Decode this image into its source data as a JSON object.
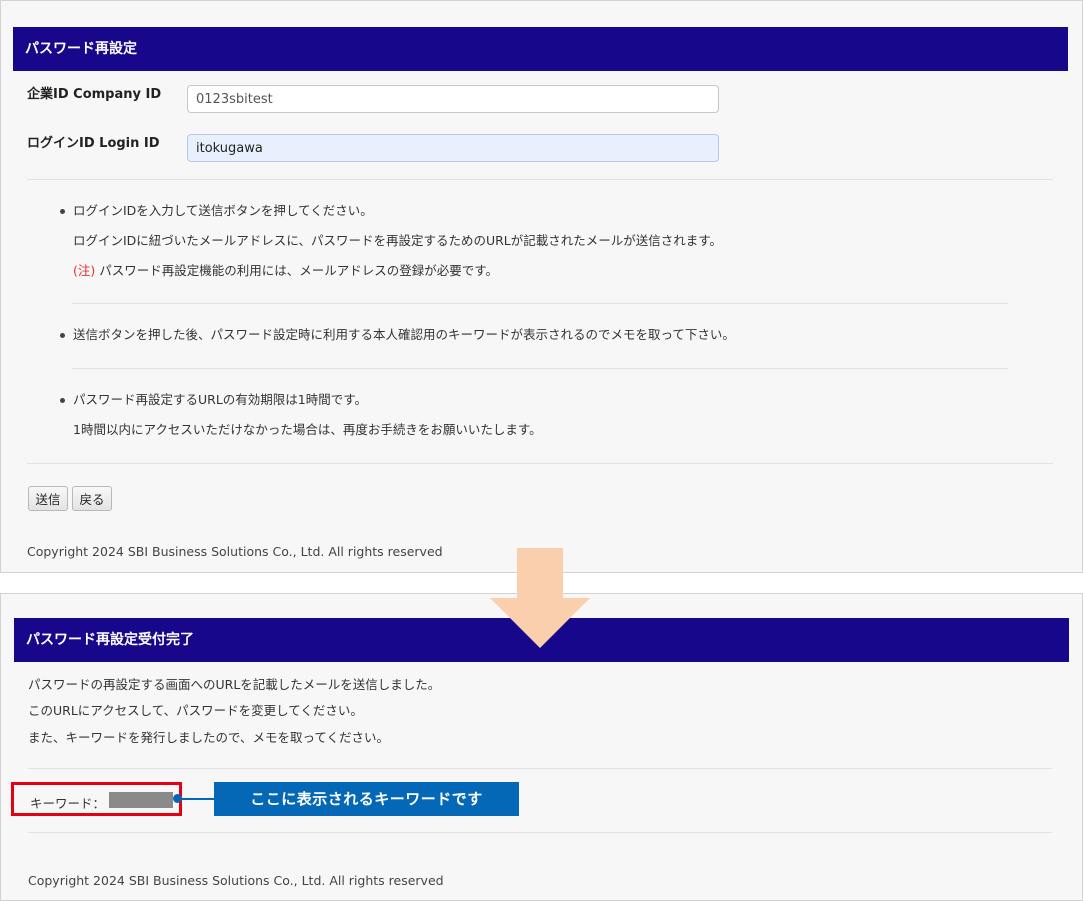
{
  "reset_form": {
    "title": "パスワード再設定",
    "company_id_label": "企業ID Company ID",
    "company_id_value": "0123sbitest",
    "login_id_label": "ログインID Login ID",
    "login_id_value": "itokugawa",
    "notes": [
      {
        "line1": "ログインIDを入力して送信ボタンを押してください。",
        "line2": "ログインIDに紐づいたメールアドレスに、パスワードを再設定するためのURLが記載されたメールが送信されます。",
        "caution_mark": "(注)",
        "caution_text": " パスワード再設定機能の利用には、メールアドレスの登録が必要です。"
      },
      {
        "line1": "送信ボタンを押した後、パスワード設定時に利用する本人確認用のキーワードが表示されるのでメモを取って下さい。"
      },
      {
        "line1": "パスワード再設定するURLの有効期限は1時間です。",
        "line2": "1時間以内にアクセスいただけなかった場合は、再度お手続きをお願いいたします。"
      }
    ],
    "submit_label": "送信",
    "back_label": "戻る",
    "copyright": "Copyright 2024 SBI Business Solutions Co., Ltd. All rights reserved"
  },
  "complete": {
    "title": "パスワード再設定受付完了",
    "messages": [
      "パスワードの再設定する画面へのURLを記載したメールを送信しました。",
      "このURLにアクセスして、パスワードを変更してください。",
      "また、キーワードを発行しましたので、メモを取ってください。"
    ],
    "keyword_label": "キーワード：",
    "copyright": "Copyright 2024 SBI Business Solutions Co., Ltd. All rights reserved"
  },
  "annotation": {
    "callout_text": "ここに表示されるキーワードです"
  },
  "colors": {
    "header_bg": "#17078b",
    "arrow": "#f9cfae",
    "highlight_border": "#e50012",
    "callout_bg": "#0568b7",
    "caution": "#e3342f"
  }
}
